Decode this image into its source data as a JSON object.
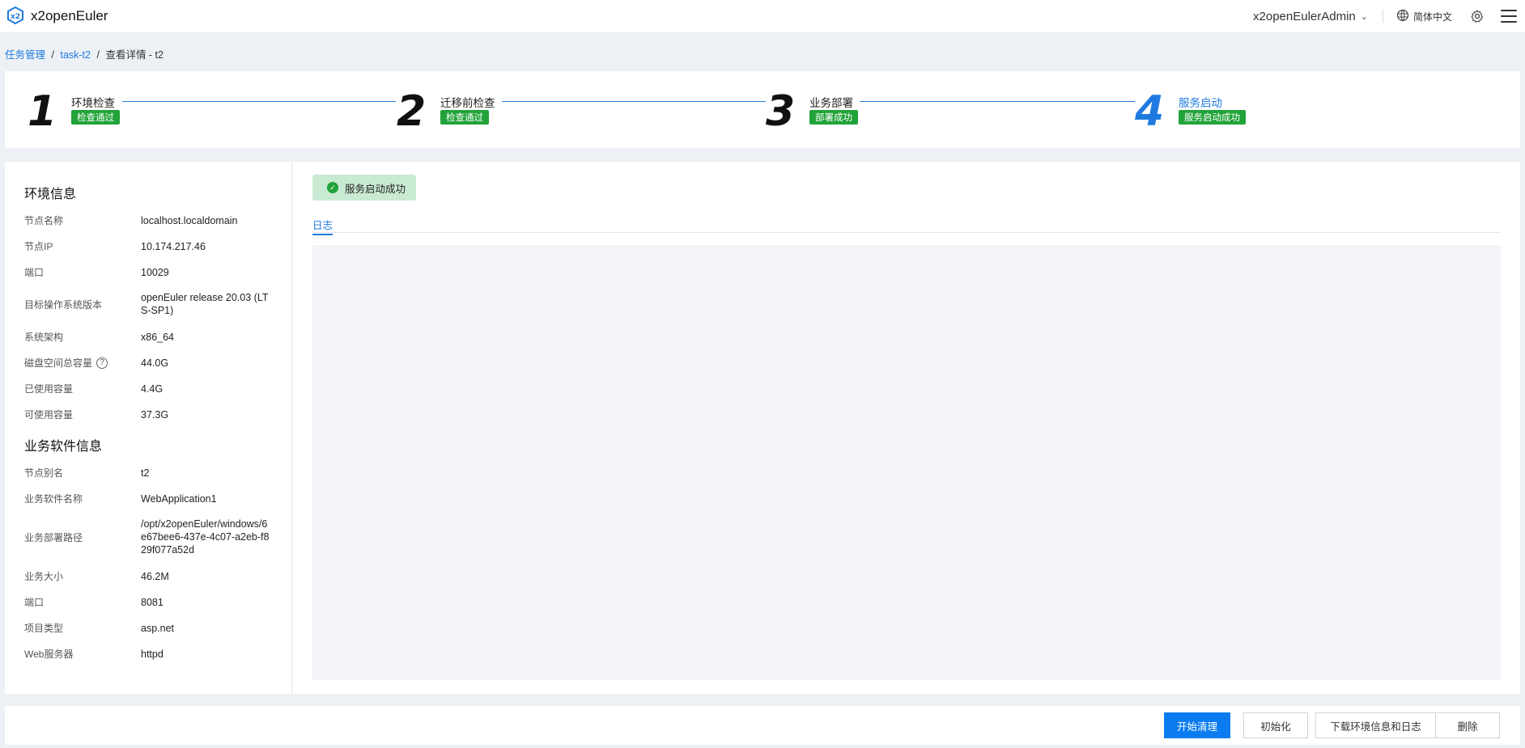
{
  "app": {
    "title": "x2openEuler",
    "logo_icon": "x2openeuler-logo"
  },
  "header": {
    "user": "x2openEulerAdmin",
    "language": "简体中文"
  },
  "breadcrumb": {
    "root": "任务管理",
    "task": "task-t2",
    "current": "查看详情 - t2",
    "separator": "/"
  },
  "steps": [
    {
      "num": "1",
      "title": "环境检查",
      "badge": "检查通过"
    },
    {
      "num": "2",
      "title": "迁移前检查",
      "badge": "检查通过"
    },
    {
      "num": "3",
      "title": "业务部署",
      "badge": "部署成功"
    },
    {
      "num": "4",
      "title": "服务启动",
      "badge": "服务启动成功"
    }
  ],
  "env": {
    "title": "环境信息",
    "rows": [
      {
        "k": "节点名称",
        "v": "localhost.localdomain"
      },
      {
        "k": "节点IP",
        "v": "10.174.217.46"
      },
      {
        "k": "端口",
        "v": "10029"
      },
      {
        "k": "目标操作系统版本",
        "v": "openEuler release 20.03 (LTS-SP1)"
      },
      {
        "k": "系统架构",
        "v": "x86_64"
      },
      {
        "k": "磁盘空间总容量",
        "v": "44.0G"
      },
      {
        "k": "已使用容量",
        "v": "4.4G"
      },
      {
        "k": "可使用容量",
        "v": "37.3G"
      }
    ]
  },
  "biz": {
    "title": "业务软件信息",
    "rows": [
      {
        "k": "节点别名",
        "v": "t2"
      },
      {
        "k": "业务软件名称",
        "v": "WebApplication1"
      },
      {
        "k": "业务部署路径",
        "v": "/opt/x2openEuler/windows/6e67bee6-437e-4c07-a2eb-f829f077a52d"
      },
      {
        "k": "业务大小",
        "v": "46.2M"
      },
      {
        "k": "端口",
        "v": "8081"
      },
      {
        "k": "项目类型",
        "v": "asp.net"
      },
      {
        "k": "Web服务器",
        "v": "httpd"
      }
    ]
  },
  "status": {
    "text": "服务启动成功",
    "color": "#21a339"
  },
  "log_tab": "日志",
  "footer": {
    "btn_clean": "开始清理",
    "btn_init": "初始化",
    "btn_download": "下载环境信息和日志",
    "btn_delete": "删除"
  },
  "colors": {
    "accent": "#1f7ae0",
    "success": "#21a339",
    "primary_button": "#0a7cf0"
  }
}
